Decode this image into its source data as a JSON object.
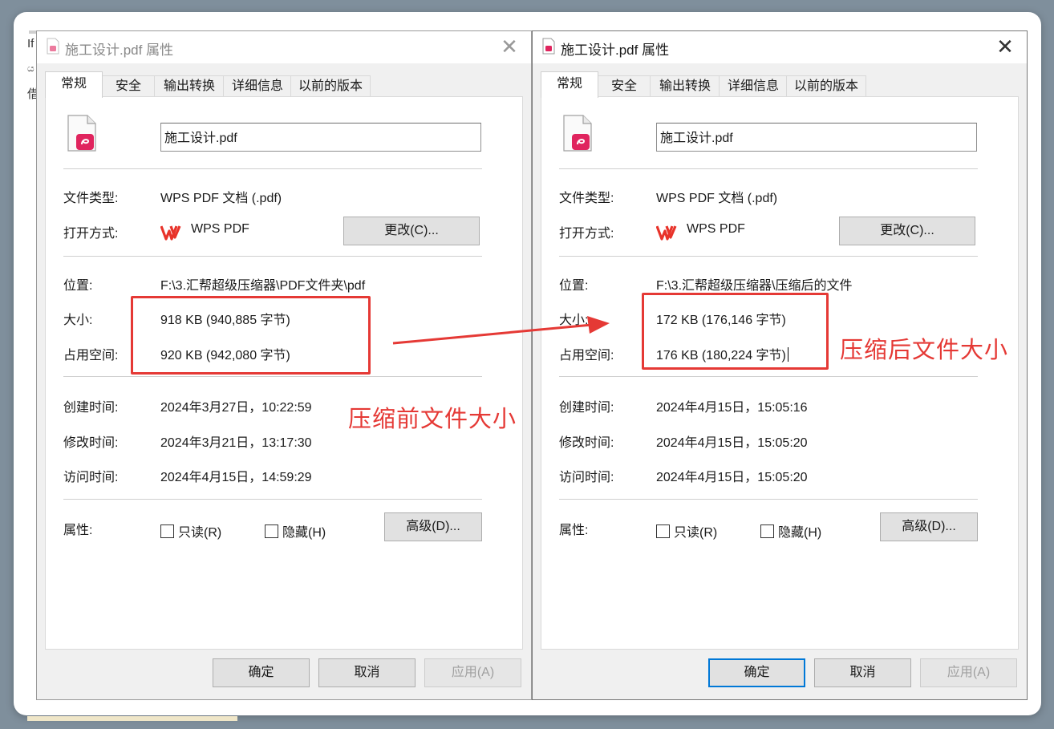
{
  "background_window": {
    "fragments": [
      "If",
      "ය",
      "借"
    ]
  },
  "left_dialog": {
    "title": "施工设计.pdf 属性",
    "close_glyph": "✕",
    "tabs": [
      "常规",
      "安全",
      "输出转换",
      "详细信息",
      "以前的版本"
    ],
    "file_name": "施工设计.pdf",
    "rows": {
      "type_label": "文件类型:",
      "type_value": "WPS PDF 文档 (.pdf)",
      "open_label": "打开方式:",
      "open_app": "WPS PDF",
      "change_button": "更改(C)...",
      "location_label": "位置:",
      "location_value": "F:\\3.汇帮超级压缩器\\PDF文件夹\\pdf",
      "size_label": "大小:",
      "size_value": "918 KB (940,885 字节)",
      "disk_label": "占用空间:",
      "disk_value": "920 KB (942,080 字节)",
      "created_label": "创建时间:",
      "created_value": "2024年3月27日，10:22:59",
      "modified_label": "修改时间:",
      "modified_value": "2024年3月21日，13:17:30",
      "accessed_label": "访问时间:",
      "accessed_value": "2024年4月15日，14:59:29",
      "attr_label": "属性:",
      "readonly": "只读(R)",
      "hidden": "隐藏(H)",
      "advanced_button": "高级(D)..."
    },
    "footer": {
      "ok": "确定",
      "cancel": "取消",
      "apply": "应用(A)"
    },
    "annotation": "压缩前文件大小"
  },
  "right_dialog": {
    "title": "施工设计.pdf 属性",
    "close_glyph": "✕",
    "tabs": [
      "常规",
      "安全",
      "输出转换",
      "详细信息",
      "以前的版本"
    ],
    "file_name": "施工设计.pdf",
    "rows": {
      "type_label": "文件类型:",
      "type_value": "WPS PDF 文档 (.pdf)",
      "open_label": "打开方式:",
      "open_app": "WPS PDF",
      "change_button": "更改(C)...",
      "location_label": "位置:",
      "location_value": "F:\\3.汇帮超级压缩器\\压缩后的文件",
      "size_label": "大小:",
      "size_value": "172 KB (176,146 字节)",
      "disk_label": "占用空间:",
      "disk_value": "176 KB (180,224 字节)",
      "created_label": "创建时间:",
      "created_value": "2024年4月15日，15:05:16",
      "modified_label": "修改时间:",
      "modified_value": "2024年4月15日，15:05:20",
      "accessed_label": "访问时间:",
      "accessed_value": "2024年4月15日，15:05:20",
      "attr_label": "属性:",
      "readonly": "只读(R)",
      "hidden": "隐藏(H)",
      "advanced_button": "高级(D)..."
    },
    "footer": {
      "ok": "确定",
      "cancel": "取消",
      "apply": "应用(A)"
    },
    "annotation": "压缩后文件大小"
  },
  "colors": {
    "annotation_red": "#e53935",
    "default_button_border": "#0078d7",
    "pdf_icon_red": "#e0245e",
    "wps_red": "#e8332a"
  }
}
